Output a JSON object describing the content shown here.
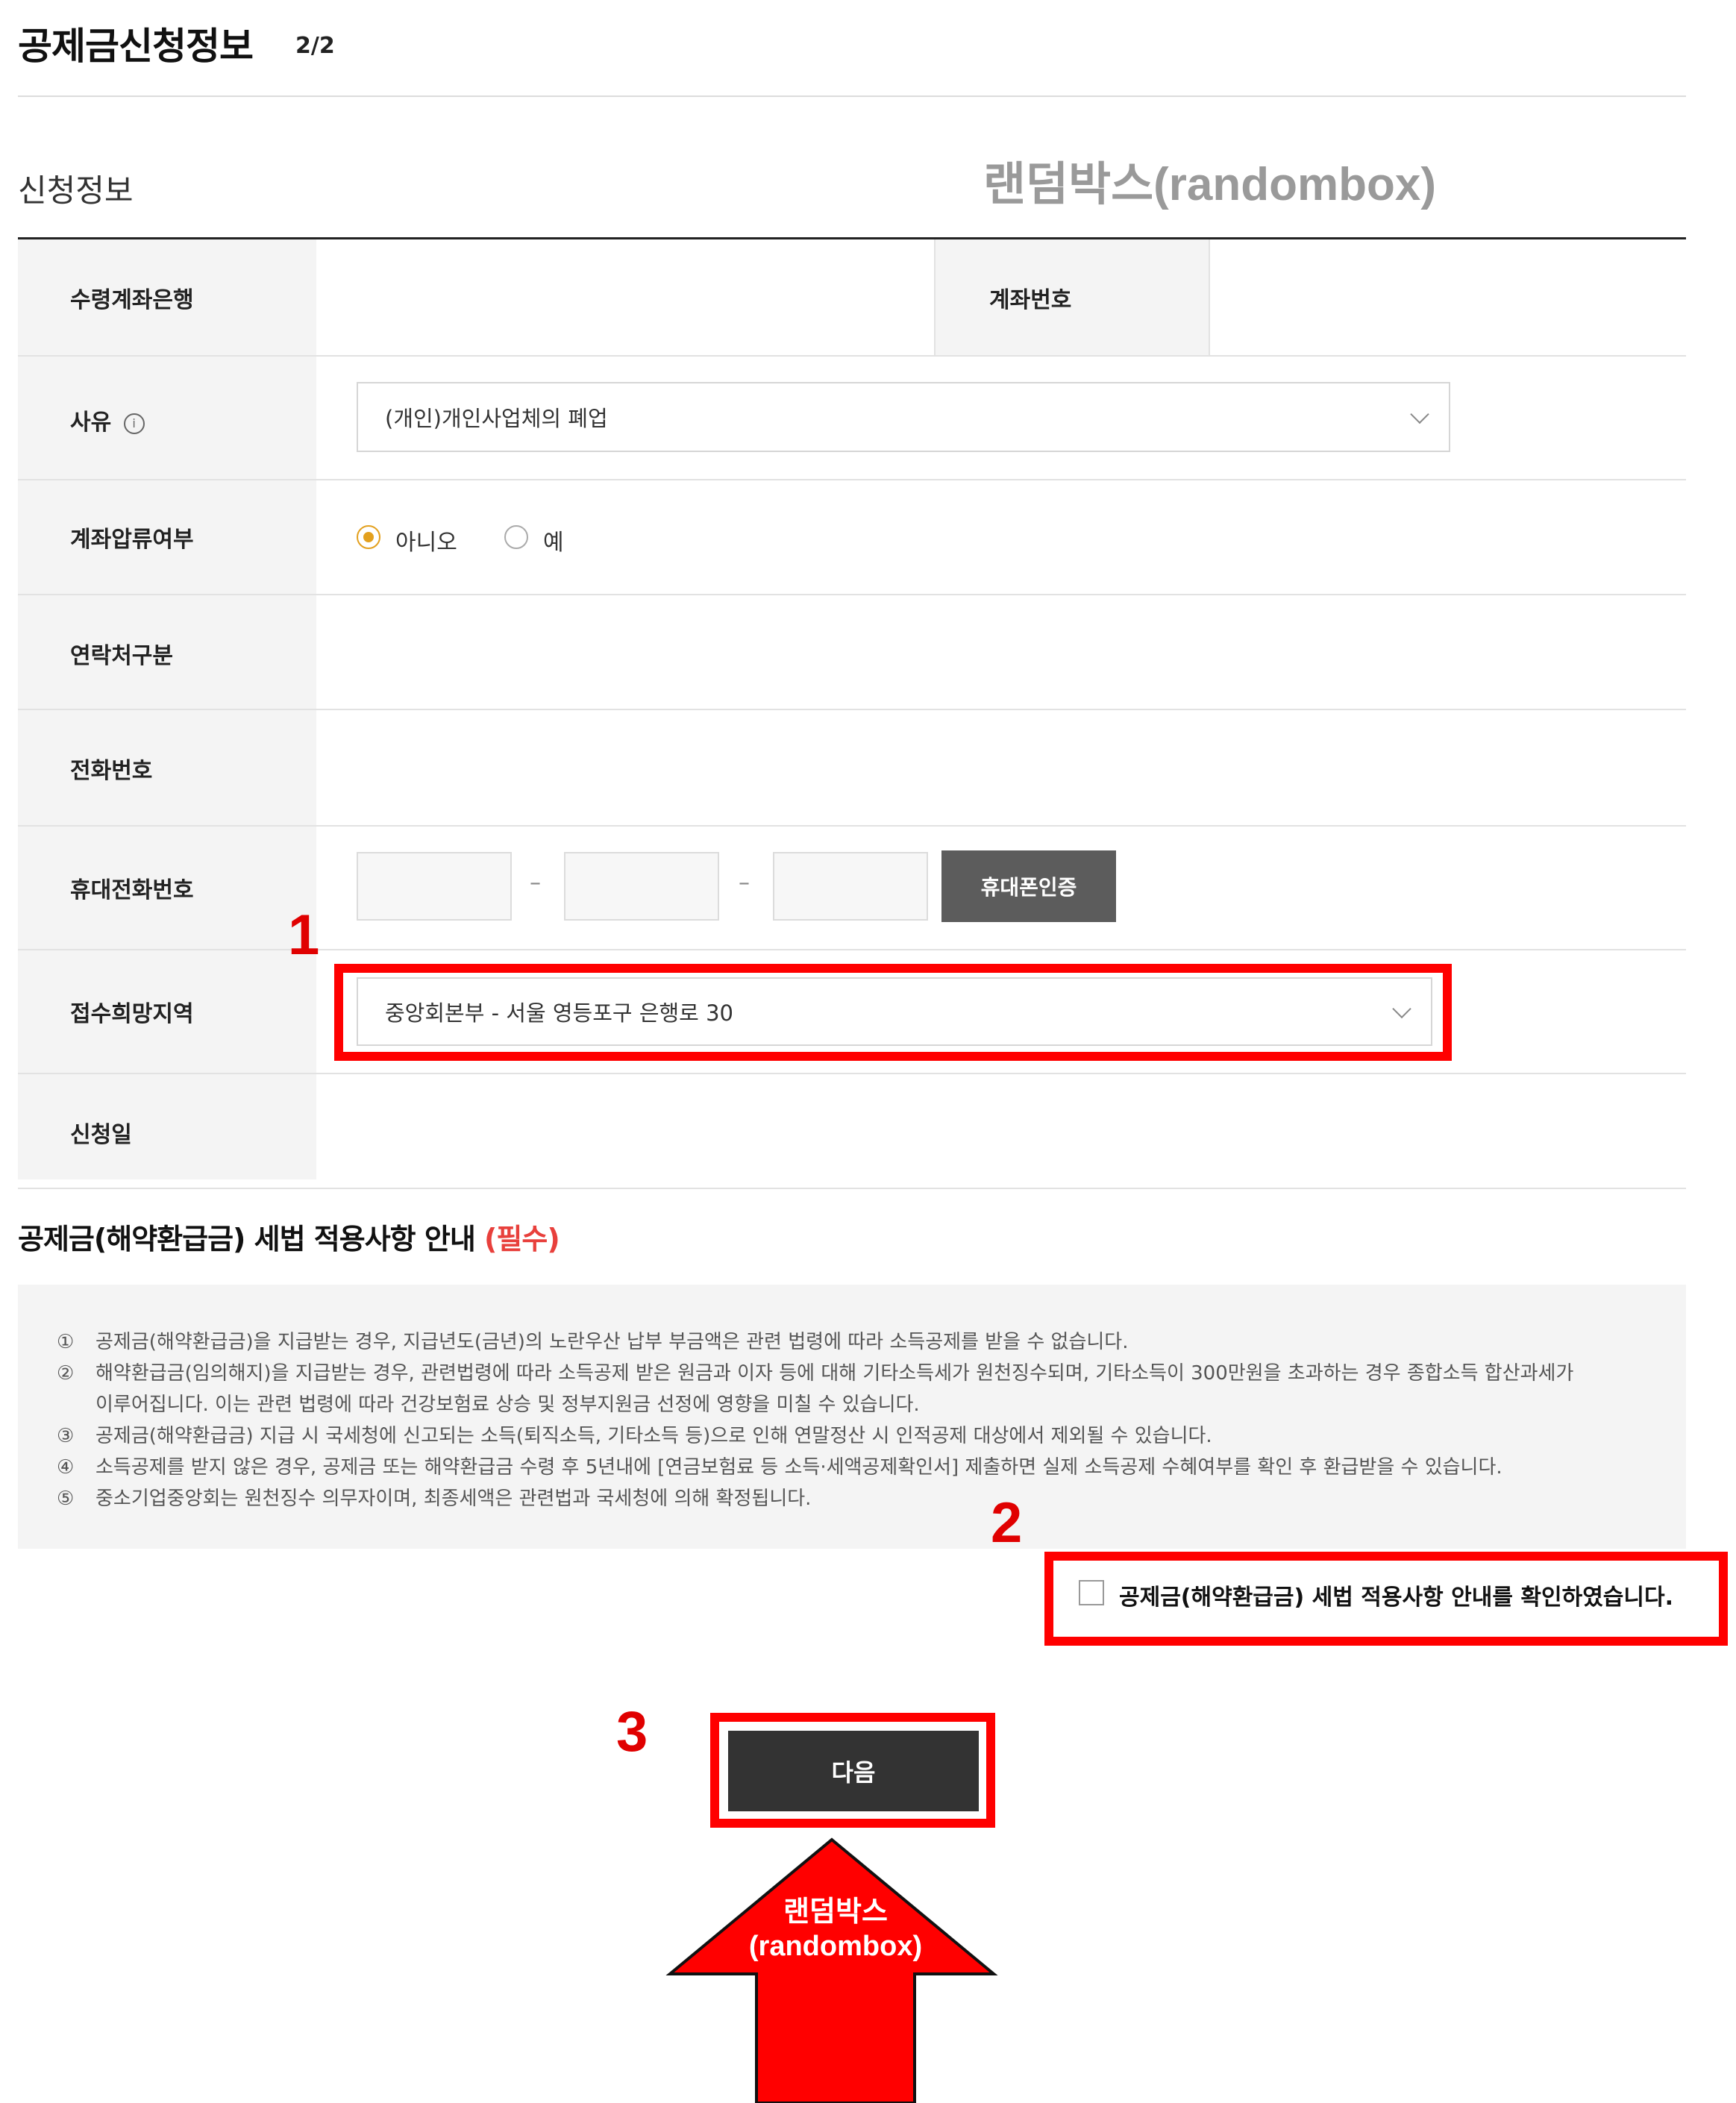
{
  "header": {
    "title": "공제금신청정보",
    "step": "2/2"
  },
  "section_title": "신청정보",
  "watermark": "랜덤박스(randombox)",
  "form": {
    "bank_label": "수령계좌은행",
    "account_label": "계좌번호",
    "reason_label": "사유",
    "reason_value": "(개인)개인사업체의 폐업",
    "seizure_label": "계좌압류여부",
    "seizure_no": "아니오",
    "seizure_yes": "예",
    "contact_type_label": "연락처구분",
    "phone_label": "전화번호",
    "mobile_label": "휴대전화번호",
    "mobile_auth_button": "휴대폰인증",
    "region_label": "접수희망지역",
    "region_value": "중앙회본부 - 서울 영등포구 은행로 30",
    "date_label": "신청일"
  },
  "notice": {
    "title": "공제금(해약환급금) 세법 적용사항 안내",
    "required": "(필수)",
    "items": [
      {
        "mark": "①",
        "text": "공제금(해약환급금)을 지급받는 경우, 지급년도(금년)의 노란우산 납부 부금액은 관련 법령에 따라 소득공제를 받을 수 없습니다."
      },
      {
        "mark": "②",
        "text": "해약환급금(임의해지)을 지급받는 경우, 관련법령에 따라 소득공제 받은 원금과 이자 등에 대해 기타소득세가 원천징수되며, 기타소득이 300만원을 초과하는 경우 종합소득 합산과세가"
      },
      {
        "mark": "",
        "text": "이루어집니다. 이는 관련 법령에 따라 건강보험료 상승 및 정부지원금 선정에 영향을 미칠 수 있습니다."
      },
      {
        "mark": "③",
        "text": "공제금(해약환급금) 지급 시 국세청에 신고되는 소득(퇴직소득, 기타소득 등)으로 인해 연말정산 시 인적공제 대상에서 제외될 수 있습니다."
      },
      {
        "mark": "④",
        "text": "소득공제를 받지 않은 경우, 공제금 또는 해약환급금 수령 후 5년내에 [연금보험료 등 소득·세액공제확인서] 제출하면 실제 소득공제 수혜여부를 확인 후 환급받을 수 있습니다."
      },
      {
        "mark": "⑤",
        "text": "중소기업중앙회는 원천징수 의무자이며, 최종세액은 관련법과 국세청에 의해 확정됩니다."
      }
    ],
    "confirm_text": "공제금(해약환급금) 세법 적용사항 안내를 확인하였습니다."
  },
  "next_button": "다음",
  "annotations": {
    "step1": "1",
    "step2": "2",
    "step3": "3",
    "arrow_label_line1": "랜덤박스",
    "arrow_label_line2": "(randombox)"
  },
  "colors": {
    "highlight": "#ff0000",
    "radio_accent": "#e3a01e",
    "required": "#e8403c",
    "button_dark": "#333333"
  },
  "icons": {
    "reason_info": "info-icon",
    "select_arrow": "chevron-down-icon"
  }
}
